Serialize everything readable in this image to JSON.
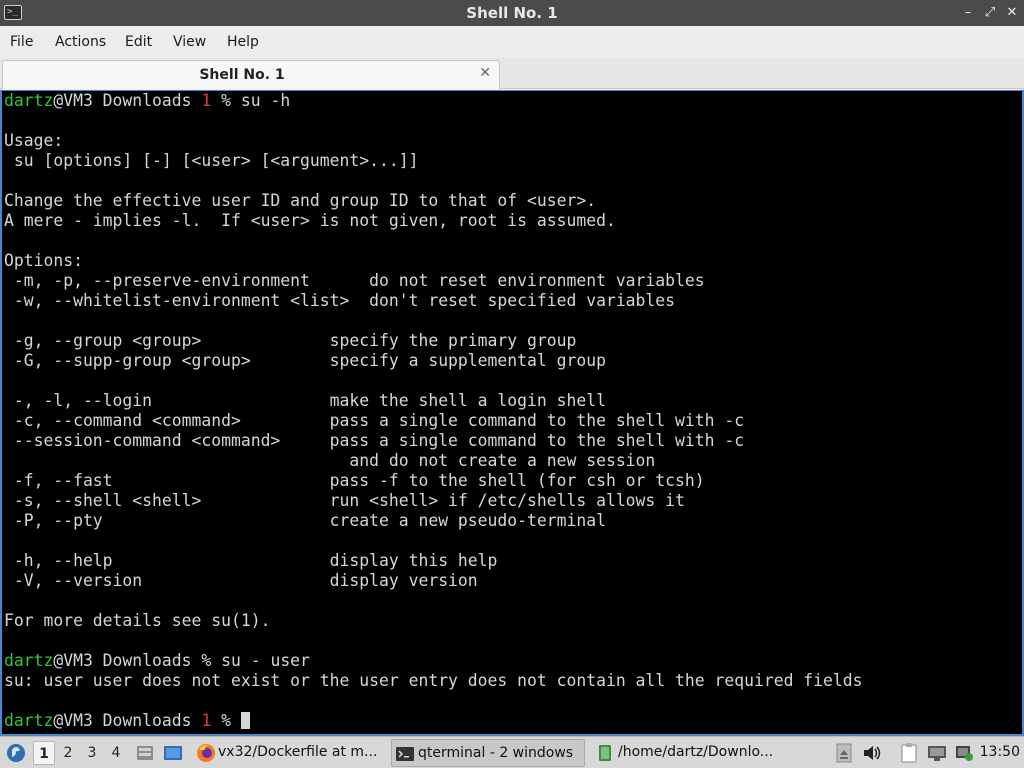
{
  "window": {
    "title": "Shell No. 1",
    "controls": {
      "minimize": "–",
      "maximize": "⤢",
      "close": "✕"
    }
  },
  "menubar": {
    "items": [
      "File",
      "Actions",
      "Edit",
      "View",
      "Help"
    ]
  },
  "tabs": [
    {
      "label": "Shell No. 1",
      "close": "✕",
      "active": true
    }
  ],
  "terminal": {
    "prompt_user": "dartz",
    "prompt_host": "@VM3 Downloads ",
    "lines": [
      {
        "type": "prompt",
        "status": "1",
        "after": " % su -h"
      },
      {
        "type": "text",
        "text": ""
      },
      {
        "type": "text",
        "text": "Usage:"
      },
      {
        "type": "text",
        "text": " su [options] [-] [<user> [<argument>...]]"
      },
      {
        "type": "text",
        "text": ""
      },
      {
        "type": "text",
        "text": "Change the effective user ID and group ID to that of <user>."
      },
      {
        "type": "text",
        "text": "A mere - implies -l.  If <user> is not given, root is assumed."
      },
      {
        "type": "text",
        "text": ""
      },
      {
        "type": "text",
        "text": "Options:"
      },
      {
        "type": "text",
        "text": " -m, -p, --preserve-environment      do not reset environment variables"
      },
      {
        "type": "text",
        "text": " -w, --whitelist-environment <list>  don't reset specified variables"
      },
      {
        "type": "text",
        "text": ""
      },
      {
        "type": "text",
        "text": " -g, --group <group>             specify the primary group"
      },
      {
        "type": "text",
        "text": " -G, --supp-group <group>        specify a supplemental group"
      },
      {
        "type": "text",
        "text": ""
      },
      {
        "type": "text",
        "text": " -, -l, --login                  make the shell a login shell"
      },
      {
        "type": "text",
        "text": " -c, --command <command>         pass a single command to the shell with -c"
      },
      {
        "type": "text",
        "text": " --session-command <command>     pass a single command to the shell with -c"
      },
      {
        "type": "text",
        "text": "                                   and do not create a new session"
      },
      {
        "type": "text",
        "text": " -f, --fast                      pass -f to the shell (for csh or tcsh)"
      },
      {
        "type": "text",
        "text": " -s, --shell <shell>             run <shell> if /etc/shells allows it"
      },
      {
        "type": "text",
        "text": " -P, --pty                       create a new pseudo-terminal"
      },
      {
        "type": "text",
        "text": ""
      },
      {
        "type": "text",
        "text": " -h, --help                      display this help"
      },
      {
        "type": "text",
        "text": " -V, --version                   display version"
      },
      {
        "type": "text",
        "text": ""
      },
      {
        "type": "text",
        "text": "For more details see su(1)."
      },
      {
        "type": "text",
        "text": ""
      },
      {
        "type": "prompt",
        "status": "",
        "after": "% su - user"
      },
      {
        "type": "text",
        "text": "su: user user does not exist or the user entry does not contain all the required fields"
      },
      {
        "type": "text",
        "text": ""
      },
      {
        "type": "prompt",
        "status": "1",
        "after": " % ",
        "cursor": true
      }
    ]
  },
  "taskbar": {
    "start_icon": "app-menu-icon",
    "workspaces": [
      "1",
      "2",
      "3",
      "4"
    ],
    "active_workspace": "1",
    "quick_launch": [
      "file-manager-icon",
      "show-desktop-icon"
    ],
    "tasks": [
      {
        "label": "vx32/Dockerfile at m...",
        "icon": "firefox-icon",
        "active": false
      },
      {
        "label": "qterminal - 2 windows",
        "icon": "terminal-icon",
        "active": true
      },
      {
        "label": "/home/dartz/Downlo...",
        "icon": "folder-icon",
        "active": false
      }
    ],
    "tray_icons": [
      "eject-icon",
      "volume-icon",
      "clipboard-icon",
      "monitor-icon",
      "network-icon"
    ],
    "clock": "13:50"
  },
  "colors": {
    "prompt_user": "#36c536",
    "prompt_status": "#e03535",
    "terminal_bg": "#000000",
    "terminal_fg": "#d6d6d6",
    "focus_border": "#4a88c9",
    "titlebar": "#4b4b4b"
  }
}
